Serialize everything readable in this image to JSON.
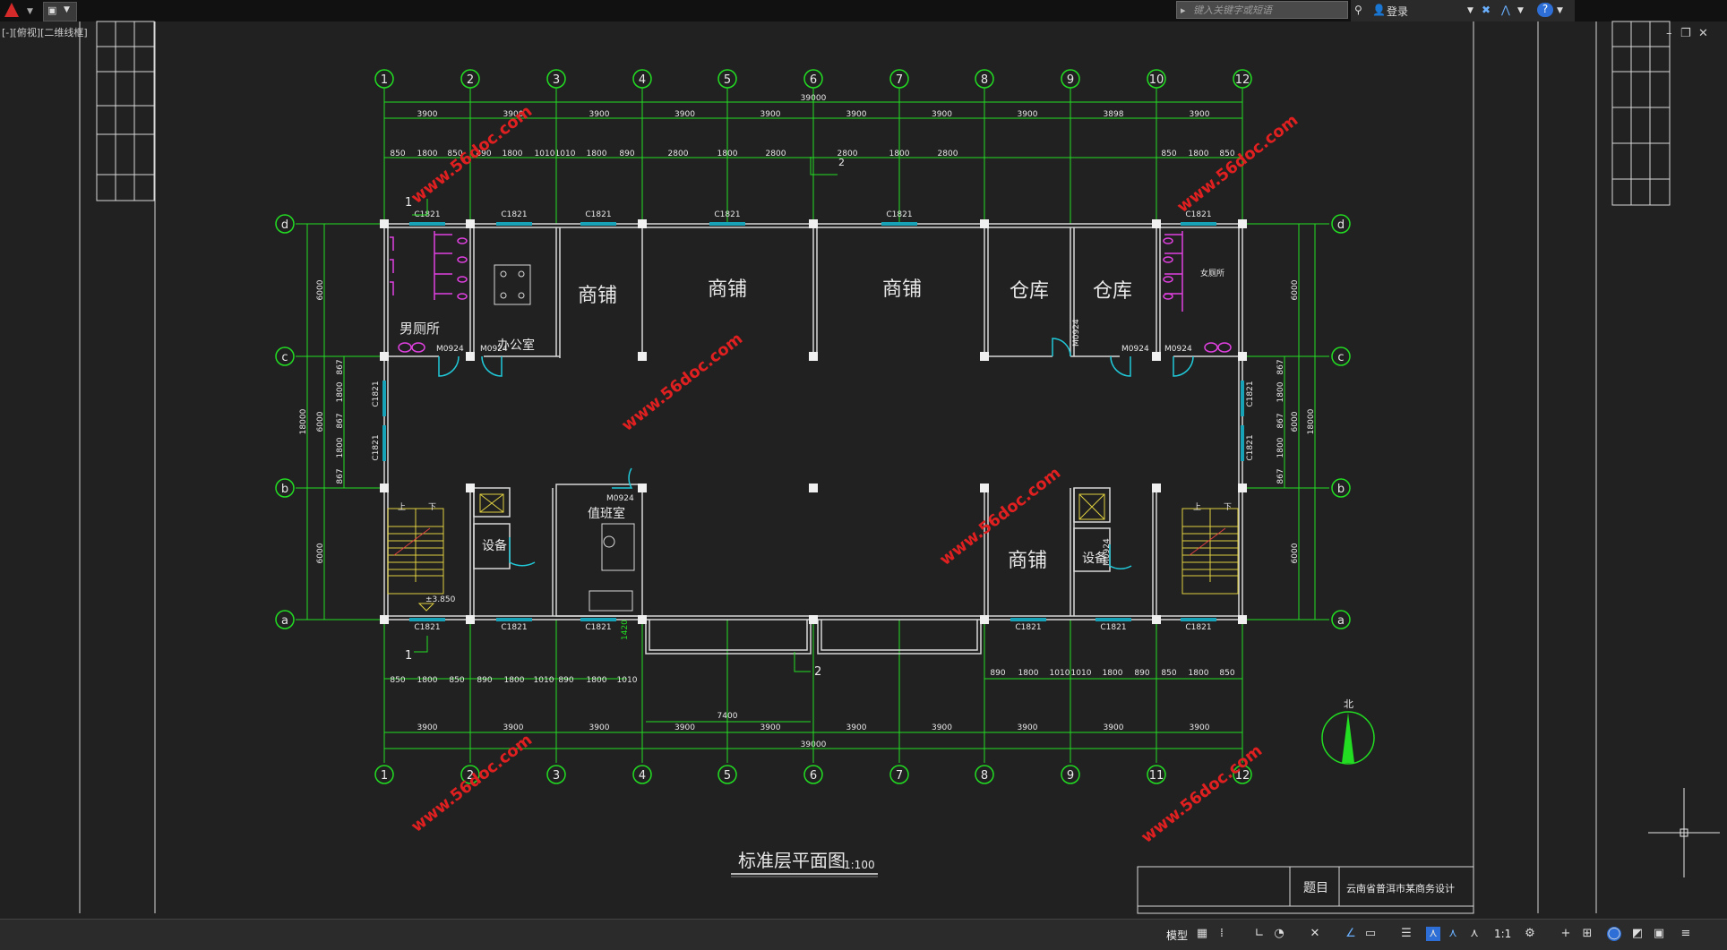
{
  "app": {
    "viewport_label": "[-][俯视][二维线框]",
    "search_placeholder": "键入关键字或短语",
    "login_label": "登录",
    "help_label": "?",
    "model_tab": "模型",
    "scale": "1:1"
  },
  "drawing": {
    "title": "标准层平面图",
    "title_scale": "1:100",
    "title_block_label": "题目",
    "title_block_value": "云南省普洱市某商务设计",
    "total_dim_top": "39000",
    "total_dim_bottom": "39000",
    "total_dim_left": "18000",
    "total_dim_right": "18000",
    "side_dim_6000": "6000",
    "col_axes": [
      "1",
      "2",
      "3",
      "4",
      "5",
      "6",
      "7",
      "8",
      "9",
      "10",
      "12"
    ],
    "col_axes_bottom": [
      "1",
      "2",
      "3",
      "4",
      "5",
      "6",
      "7",
      "8",
      "9",
      "11",
      "12"
    ],
    "row_axes": [
      "d",
      "c",
      "b",
      "a"
    ],
    "span_dims_top": [
      "3900",
      "3900",
      "3900",
      "3900",
      "3900",
      "3900",
      "3900",
      "3900",
      "3898",
      "3900"
    ],
    "span_dims_bottom": [
      "3900",
      "3900",
      "3900",
      "3900",
      "3900",
      "3900",
      "3900",
      "3900",
      "3900",
      "3900"
    ],
    "bottom_center_dim": "7400",
    "sub_dims_top": [
      "850",
      "1800",
      "850",
      "890",
      "1800",
      "1010",
      "1010",
      "1800",
      "890",
      "2800",
      "1800",
      "2800",
      "2800",
      "1800",
      "2800",
      "850",
      "1800",
      "850"
    ],
    "sub_dims_bottom_left": [
      "850",
      "1800",
      "850",
      "890",
      "1800",
      "1010",
      "890",
      "1800",
      "1010"
    ],
    "sub_dims_bottom_right": [
      "890",
      "1800",
      "1010",
      "1010",
      "1800",
      "890",
      "850",
      "1800",
      "850"
    ],
    "left_sub_dims": [
      "867",
      "1800",
      "867",
      "1800",
      "867"
    ],
    "rooms": {
      "shop": "商铺",
      "warehouse": "仓库",
      "mens_toilet": "男厕所",
      "womens_toilet": "女厕所",
      "office": "办公室",
      "duty_room": "值班室",
      "equipment": "设备",
      "stair_up": "上",
      "stair_down": "下",
      "elevation": "±3.850"
    },
    "window_tag": "C1821",
    "door_tag": "M0924",
    "height_mark": "1420",
    "section_marks": [
      "1",
      "2"
    ],
    "north_label": "北",
    "watermark": "www.56doc.com"
  },
  "colors": {
    "background": "#212121",
    "axis_green": "#22dd22",
    "wall_white": "#d8d8d8",
    "window_cyan": "#17a2b8",
    "door_cyan": "#20c8d8",
    "fixture_magenta": "#e040e0",
    "stair_yellow": "#e0d040",
    "watermark_red": "#e02020"
  }
}
